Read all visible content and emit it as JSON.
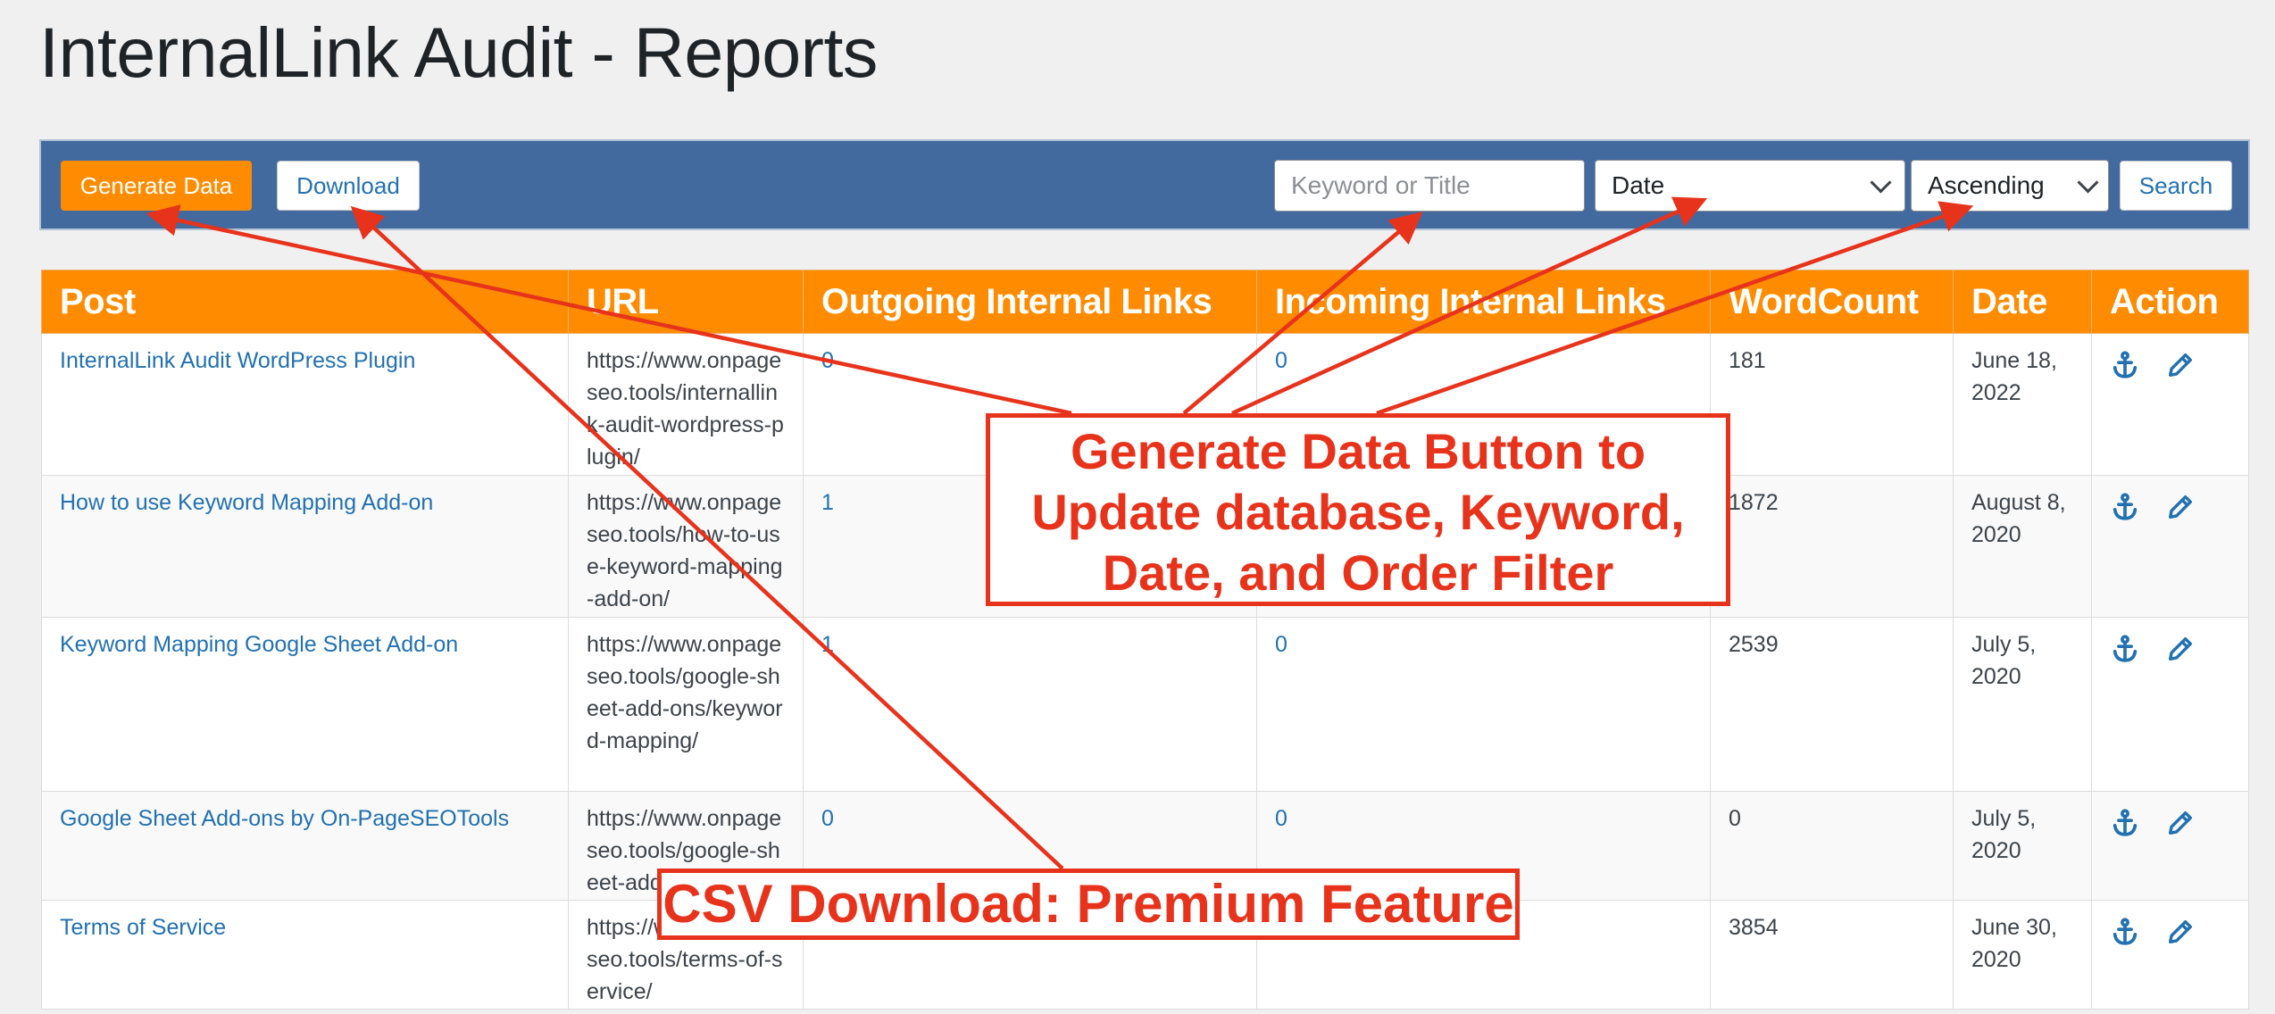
{
  "page": {
    "title": "InternalLink Audit - Reports"
  },
  "toolbar": {
    "generate_label": "Generate Data",
    "download_label": "Download",
    "keyword_placeholder": "Keyword or Title",
    "sort_field": "Date",
    "sort_order": "Ascending",
    "search_label": "Search"
  },
  "table": {
    "headers": [
      "Post",
      "URL",
      "Outgoing Internal Links",
      "Incoming Internal Links",
      "WordCount",
      "Date",
      "Action"
    ],
    "rows": [
      {
        "post": "InternalLink Audit WordPress Plugin",
        "url": "https://www.onpageseo.tools/internallink-audit-wordpress-plugin/",
        "outgoing": "0",
        "incoming": "0",
        "wordcount": "181",
        "date": "June 18, 2022"
      },
      {
        "post": "How to use Keyword Mapping Add-on",
        "url": "https://www.onpageseo.tools/how-to-use-keyword-mapping-add-on/",
        "outgoing": "1",
        "incoming": "",
        "wordcount": "1872",
        "date": "August 8, 2020"
      },
      {
        "post": "Keyword Mapping Google Sheet Add-on",
        "url": "https://www.onpageseo.tools/google-sheet-add-ons/keyword-mapping/",
        "outgoing": "1",
        "incoming": "0",
        "wordcount": "2539",
        "date": "July 5, 2020"
      },
      {
        "post": "Google Sheet Add-ons by On-PageSEOTools",
        "url": "https://www.onpageseo.tools/google-sheet-add-ons/",
        "outgoing": "0",
        "incoming": "0",
        "wordcount": "0",
        "date": "July 5, 2020"
      },
      {
        "post": "Terms of Service",
        "url": "https://www.onpageseo.tools/terms-of-service/",
        "outgoing": "",
        "incoming": "",
        "wordcount": "3854",
        "date": "June 30, 2020"
      }
    ]
  },
  "annotations": {
    "generate_callout": [
      "Generate Data Button to",
      "Update database, Keyword,",
      "Date, and Order Filter"
    ],
    "csv_callout": "CSV Download: Premium Feature",
    "color": "#e8331c"
  },
  "icons": {
    "anchor": "anchor-icon",
    "edit": "pencil-icon"
  },
  "colors": {
    "accent": "#ff8c00",
    "toolbar": "#426a9f",
    "link": "#2271b1"
  }
}
